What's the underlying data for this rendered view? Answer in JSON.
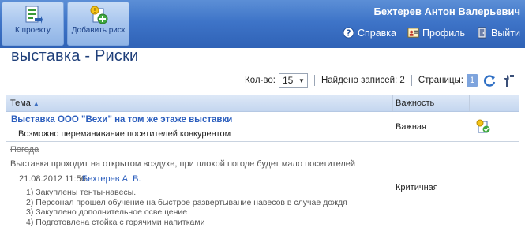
{
  "header": {
    "buttons": [
      {
        "label": "К проекту",
        "icon": "project-icon"
      },
      {
        "label": "Добавить риск",
        "icon": "add-risk-icon"
      }
    ],
    "user_name": "Бехтерев Антон Валерьевич",
    "links": [
      {
        "label": "Справка",
        "icon": "help-icon"
      },
      {
        "label": "Профиль",
        "icon": "profile-icon"
      },
      {
        "label": "Выйти",
        "icon": "logout-icon"
      }
    ]
  },
  "page_title": "выставка - Риски",
  "pager": {
    "count_label": "Кол-во:",
    "count_value": "15",
    "found_label": "Найдено записей: 2",
    "pages_label": "Страницы:",
    "current_page": "1"
  },
  "table": {
    "columns": [
      "Тема",
      "Важность"
    ],
    "rows": [
      {
        "title": "Выставка ООО \"Вехи\" на том же этаже выставки",
        "description": "Возможно переманивание посетителей конкурентом",
        "importance": "Важная"
      },
      {
        "title": "Погода",
        "description": "Выставка проходит на открытом воздухе, при плохой погоде будет мало посетителей",
        "date": "21.08.2012 11:56",
        "author": "Бехтерев А. В.",
        "actions": [
          "1) Закуплены тенты-навесы.",
          "2) Персонал прошел обучение на быстрое развертывание навесов в случае дождя",
          "3) Закуплено дополнительное освещение",
          "4) Подготовлена стойка с горячими напитками"
        ],
        "importance": "Критичная"
      }
    ]
  }
}
